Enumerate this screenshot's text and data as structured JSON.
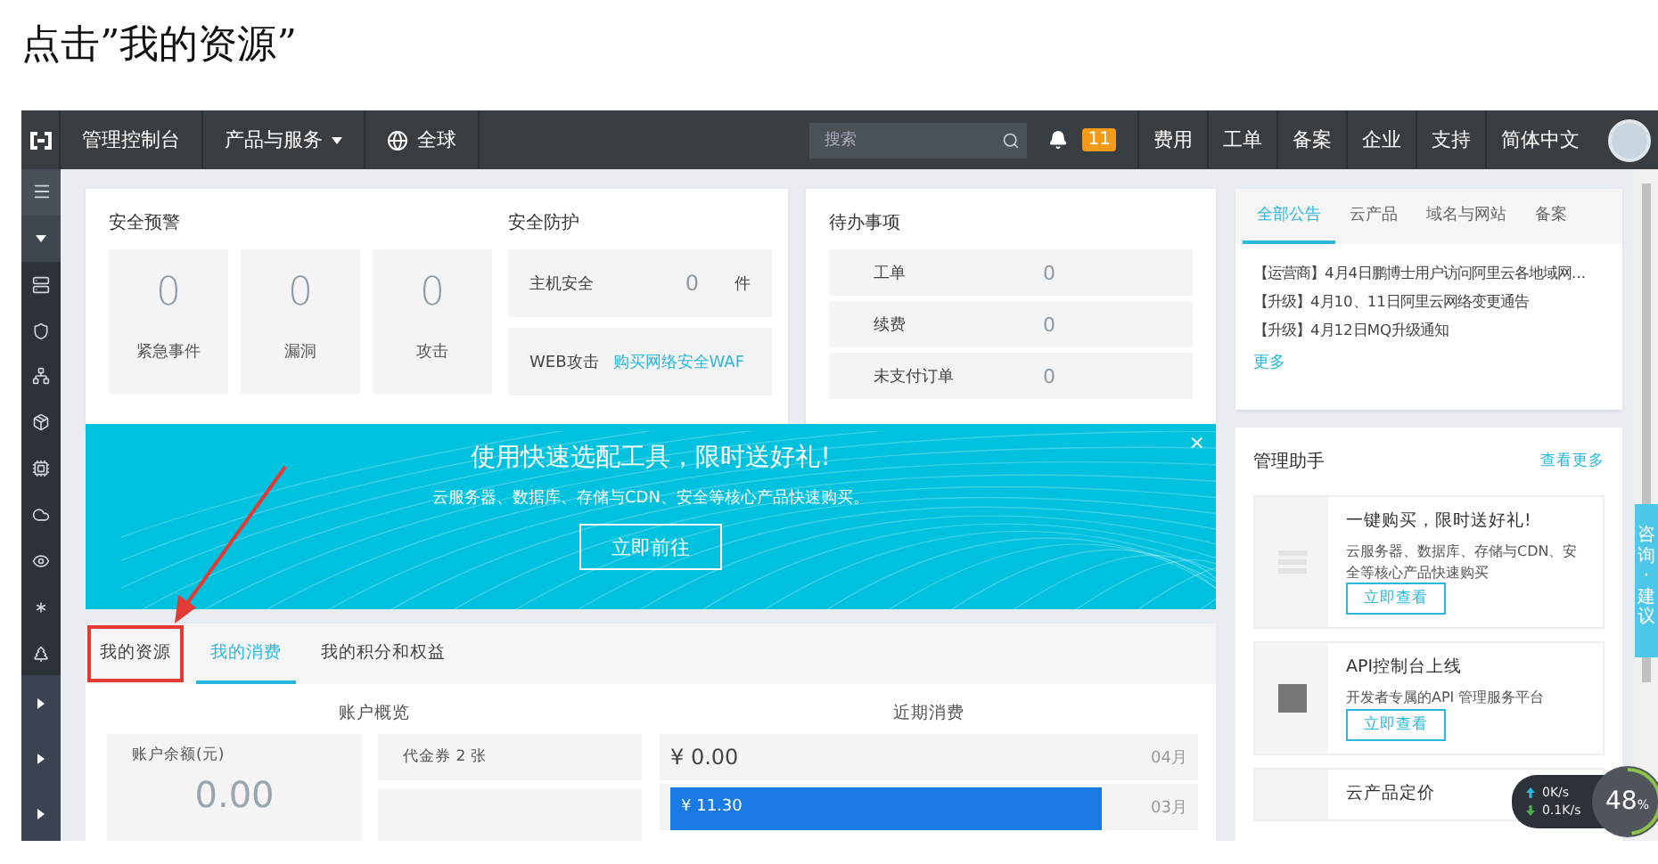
{
  "instruction": "点击”我的资源”",
  "topbar": {
    "nav": [
      "管理控制台",
      "产品与服务"
    ],
    "region": "全球",
    "search_placeholder": "搜索",
    "notification_count": "11",
    "links": [
      "费用",
      "工单",
      "备案",
      "企业",
      "支持",
      "简体中文"
    ]
  },
  "security_alerts": {
    "title": "安全预警",
    "stats": [
      {
        "value": "0",
        "label": "紧急事件"
      },
      {
        "value": "0",
        "label": "漏洞"
      },
      {
        "value": "0",
        "label": "攻击"
      }
    ]
  },
  "security_protection": {
    "title": "安全防护",
    "host": {
      "label": "主机安全",
      "value": "0",
      "unit": "件"
    },
    "web": {
      "label": "WEB攻击",
      "link": "购买网络安全WAF"
    }
  },
  "todo": {
    "title": "待办事项",
    "items": [
      {
        "label": "工单",
        "value": "0"
      },
      {
        "label": "续费",
        "value": "0"
      },
      {
        "label": "未支付订单",
        "value": "0"
      }
    ]
  },
  "notices": {
    "tabs": [
      {
        "label": "全部公告",
        "selected": true
      },
      {
        "label": "云产品",
        "selected": false
      },
      {
        "label": "域名与网站",
        "selected": false
      },
      {
        "label": "备案",
        "selected": false
      }
    ],
    "items": [
      "【运营商】4月4日鹏博士用户访问阿里云各地域网...",
      "【升级】4月10、11日阿里云网络变更通告",
      "【升级】4月12日MQ升级通知"
    ],
    "more": "更多"
  },
  "banner": {
    "title": "使用快速选配工具，限时送好礼!",
    "subtitle": "云服务器、数据库、存储与CDN、安全等核心产品快速购买。",
    "button": "立即前往",
    "close": "×"
  },
  "resource_tabs": [
    {
      "label": "我的资源",
      "selected": false,
      "highlighted": true
    },
    {
      "label": "我的消费",
      "selected": true,
      "highlighted": false
    },
    {
      "label": "我的积分和权益",
      "selected": false,
      "highlighted": false
    }
  ],
  "account_overview": {
    "title": "账户概览",
    "balance_label": "账户余额(元)",
    "balance": "0.00",
    "voucher": "代金券 2 张"
  },
  "recent_spending": {
    "title": "近期消费",
    "rows": [
      {
        "amount": "¥ 0.00",
        "month": "04月"
      },
      {
        "amount": "¥ 11.30",
        "month": "03月",
        "level": 0.8
      }
    ]
  },
  "assistant": {
    "title": "管理助手",
    "more": "查看更多",
    "cards": [
      {
        "title": "一键购买，限时送好礼!",
        "desc": "云服务器、数据库、存储与CDN、安全等核心产品快速购买",
        "button": "立即查看"
      },
      {
        "title": "API控制台上线",
        "desc": "开发者专属的API 管理服务平台",
        "button": "立即查看"
      },
      {
        "title": "云产品定价"
      }
    ]
  },
  "consult_tab": "咨询·建议",
  "speed_widget": {
    "up": "0K/s",
    "down": "0.1K/s",
    "percent": "48",
    "unit": "%",
    "level": 0.48
  }
}
